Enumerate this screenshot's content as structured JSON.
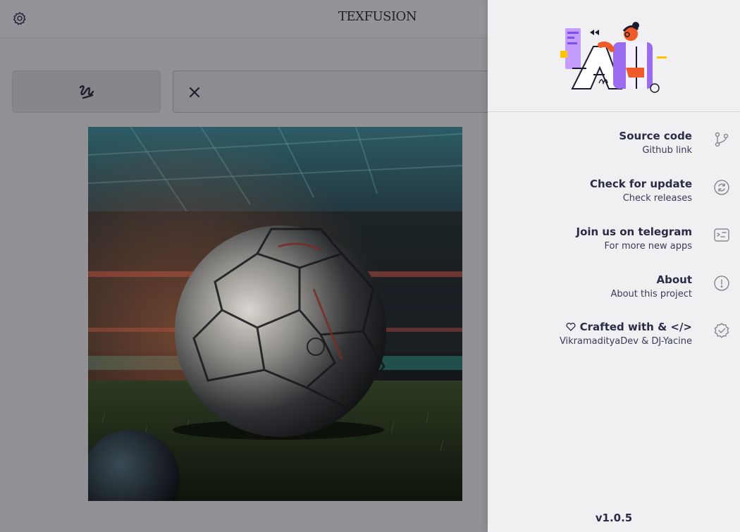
{
  "app": {
    "brand": "TEXFUSION",
    "icons": {
      "settings": "gear-icon",
      "prompt": "scribble-icon",
      "clear": "close-icon"
    },
    "prompt_input": {
      "value": "",
      "placeholder": ""
    }
  },
  "drawer": {
    "menu": [
      {
        "title": "Source code",
        "subtitle": "Github link",
        "icon": "git-branch-icon"
      },
      {
        "title": "Check for update",
        "subtitle": "Check releases",
        "icon": "refresh-icon"
      },
      {
        "title": "Join us on telegram",
        "subtitle": "For more new apps",
        "icon": "message-icon"
      },
      {
        "title": "About",
        "subtitle": "About this project",
        "icon": "info-icon"
      },
      {
        "title": "Crafted with & </>",
        "subtitle": "VikramadityaDev & DJ-Yacine",
        "icon": "badge-check-icon"
      }
    ],
    "version": "v1.0.5"
  },
  "colors": {
    "drawer_bg": "#f0eff2",
    "text_dark": "#2a2b45",
    "accent_purple": "#9b6cf0",
    "accent_orange": "#f05a28"
  }
}
